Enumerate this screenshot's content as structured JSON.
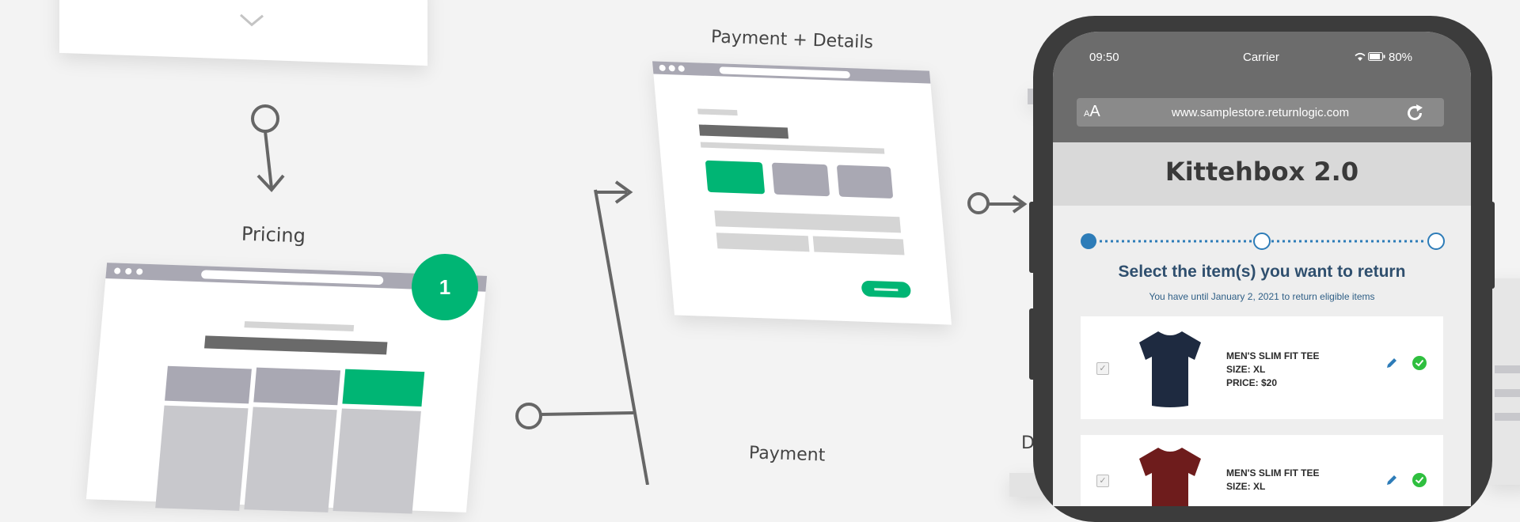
{
  "wireframes": {
    "pricing": {
      "title": "Pricing",
      "step_badge": "1"
    },
    "payment_details": {
      "title": "Payment + Details"
    },
    "payment": {
      "title": "Payment"
    },
    "partial_label": "D"
  },
  "phone": {
    "status": {
      "time": "09:50",
      "carrier": "Carrier",
      "battery": "80%"
    },
    "browser": {
      "text_size_icon": "text-size-icon",
      "url": "www.samplestore.returnlogic.com",
      "reload_icon": "reload-icon"
    },
    "store_title": "Kittehbox 2.0",
    "heading": "Select the item(s) you want to return",
    "subheading": "You have until January 2, 2021 to return eligible items",
    "items": [
      {
        "name": "MEN'S SLIM FIT TEE",
        "size": "SIZE: XL",
        "price": "PRICE: $20",
        "shirt_color": "#1e2a40",
        "checked": true
      },
      {
        "name": "MEN'S SLIM FIT TEE",
        "size": "SIZE: XL",
        "price": "",
        "shirt_color": "#6e1c1c",
        "checked": true
      }
    ]
  },
  "colors": {
    "accent_green": "#00b574",
    "progress_blue": "#2d7cb8",
    "heading_blue": "#2f4f6e",
    "wire_gray": "#a9a8b3"
  }
}
